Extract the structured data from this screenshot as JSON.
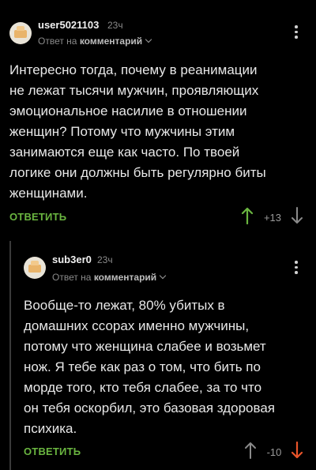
{
  "comments": [
    {
      "username": "user5021103",
      "time": "23ч",
      "reply_prefix": "Ответ на",
      "reply_target": "комментарий",
      "text_lines": [
        "Интересно тогда, почему в реанимации",
        "не лежат тысячи мужчин, проявляющих",
        "эмоциональное насилие в отношении",
        "женщин? Потому что мужчины этим",
        "занимаются еще как часто. По твоей",
        "логике они должны быть регулярно биты",
        "женщинами."
      ],
      "reply_label": "ОТВЕТИТЬ",
      "rating": "+13",
      "vote_state": "up"
    },
    {
      "username": "sub3er0",
      "time": "23ч",
      "reply_prefix": "Ответ на",
      "reply_target": "комментарий",
      "text_lines": [
        "Вообще-то лежат, 80% убитых в",
        "домашних ссорах именно мужчины,",
        "потому что женщина слабее и возьмет",
        "нож. Я тебе как раз о том, что бить по",
        "морде того, кто тебя слабее, за то что",
        "он тебя оскорбил, это базовая здоровая",
        "психика."
      ],
      "reply_label": "ОТВЕТИТЬ",
      "rating": "-10",
      "vote_state": "down"
    }
  ],
  "colors": {
    "background": "#000000",
    "accent_green": "#6ab540",
    "downvote_orange": "#e8542a",
    "muted_text": "#8a8a8a"
  },
  "icons": [
    "avatar-icon",
    "kebab-menu-icon",
    "chevron-down-icon",
    "arrow-up-icon",
    "arrow-down-icon"
  ]
}
